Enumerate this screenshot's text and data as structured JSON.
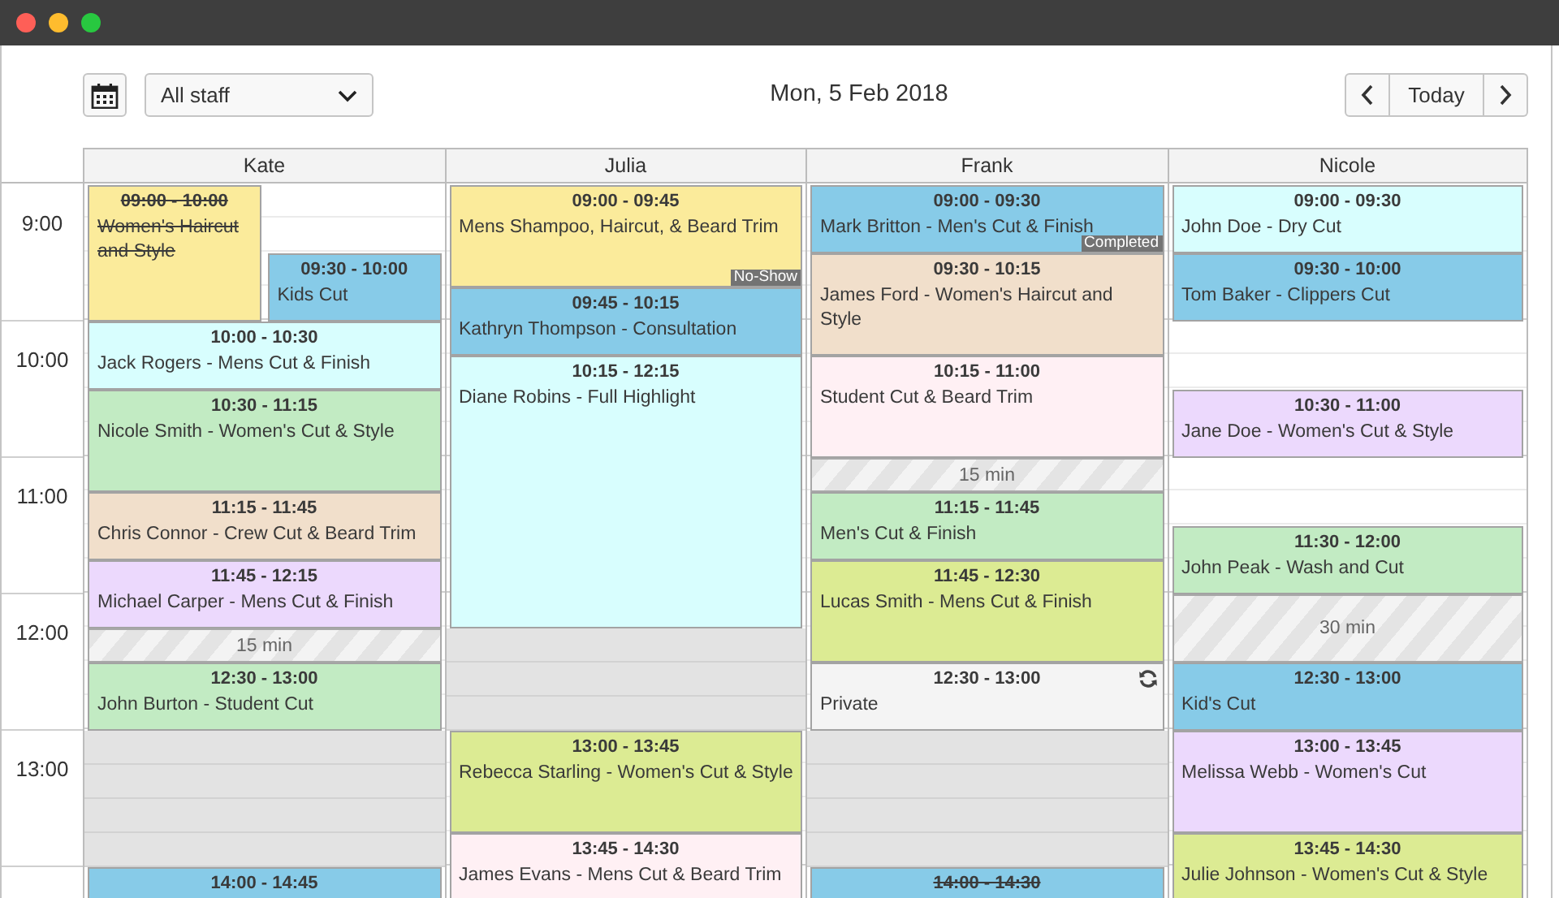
{
  "toolbar": {
    "staff_filter": "All staff",
    "date": "Mon, 5 Feb 2018",
    "today_button": "Today"
  },
  "time_labels": [
    "9:00",
    "10:00",
    "11:00",
    "12:00",
    "13:00"
  ],
  "staff": [
    {
      "name": "Kate",
      "blocks": [
        {
          "kind": "appointment",
          "time": "09:00 - 10:00",
          "title": "Women's Haircut and Style",
          "color": "#fbeb9b",
          "cancelled": true,
          "recurring": false
        },
        {
          "kind": "appointment",
          "time": "09:30 - 10:00",
          "title": "Kids Cut",
          "color": "#87cbe8",
          "cancelled": false,
          "recurring": false
        },
        {
          "kind": "appointment",
          "time": "10:00 - 10:30",
          "title": "Jack Rogers - Mens Cut & Finish",
          "color": "#d8fefe",
          "cancelled": false,
          "recurring": false
        },
        {
          "kind": "appointment",
          "time": "10:30 - 11:15",
          "title": "Nicole Smith - Women's Cut & Style",
          "color": "#c2ebc3",
          "cancelled": false,
          "recurring": false
        },
        {
          "kind": "appointment",
          "time": "11:15 - 11:45",
          "title": "Chris Connor - Crew Cut & Beard Trim",
          "color": "#f1dfcb",
          "cancelled": false,
          "recurring": false
        },
        {
          "kind": "appointment",
          "time": "11:45 - 12:15",
          "title": "Michael Carper - Mens Cut & Finish",
          "color": "#ecd9fd",
          "cancelled": false,
          "recurring": false
        },
        {
          "kind": "break",
          "label": "15 min"
        },
        {
          "kind": "appointment",
          "time": "12:30 - 13:00",
          "title": "John Burton - Student Cut",
          "color": "#c2ebc3",
          "cancelled": false,
          "recurring": false
        },
        {
          "kind": "unavailable"
        },
        {
          "kind": "appointment",
          "time": "14:00 - 14:45",
          "color": "#87cbe8",
          "cancelled": false,
          "recurring": false
        }
      ]
    },
    {
      "name": "Julia",
      "blocks": [
        {
          "kind": "appointment",
          "time": "09:00 - 09:45",
          "title": "Mens Shampoo, Haircut, & Beard Trim",
          "color": "#fbeb9b",
          "cancelled": false,
          "recurring": false,
          "status": "No-Show"
        },
        {
          "kind": "appointment",
          "time": "09:45 - 10:15",
          "title": "Kathryn Thompson - Consultation",
          "color": "#87cbe8",
          "cancelled": false,
          "recurring": false
        },
        {
          "kind": "appointment",
          "time": "10:15 - 12:15",
          "title": "Diane Robins - Full Highlight",
          "color": "#d8fefe",
          "cancelled": false,
          "recurring": false
        },
        {
          "kind": "unavailable"
        },
        {
          "kind": "appointment",
          "time": "13:00 - 13:45",
          "title": "Rebecca Starling - Women's Cut & Style",
          "color": "#dceb93",
          "cancelled": false,
          "recurring": false
        },
        {
          "kind": "appointment",
          "time": "13:45 - 14:30",
          "title": "James Evans - Mens Cut & Beard Trim",
          "color": "#fff0f4",
          "cancelled": false,
          "recurring": false
        }
      ]
    },
    {
      "name": "Frank",
      "blocks": [
        {
          "kind": "appointment",
          "time": "09:00 - 09:30",
          "title": "Mark Britton - Men's Cut & Finish",
          "color": "#87cbe8",
          "cancelled": false,
          "recurring": false,
          "status": "Completed"
        },
        {
          "kind": "appointment",
          "time": "09:30 - 10:15",
          "title": "James Ford - Women's Haircut and Style",
          "color": "#f1dfcb",
          "cancelled": false,
          "recurring": false
        },
        {
          "kind": "appointment",
          "time": "10:15 - 11:00",
          "title": "Student Cut & Beard Trim",
          "color": "#fff0f4",
          "cancelled": false,
          "recurring": false
        },
        {
          "kind": "break",
          "label": "15 min"
        },
        {
          "kind": "appointment",
          "time": "11:15 - 11:45",
          "title": "Men's Cut & Finish",
          "color": "#c2ebc3",
          "cancelled": false,
          "recurring": false
        },
        {
          "kind": "appointment",
          "time": "11:45 - 12:30",
          "title": "Lucas Smith - Mens Cut & Finish",
          "color": "#dceb93",
          "cancelled": false,
          "recurring": false
        },
        {
          "kind": "appointment",
          "time": "12:30 - 13:00",
          "title": "Private",
          "color": "#f4f4f4",
          "cancelled": false,
          "recurring": true
        },
        {
          "kind": "unavailable"
        },
        {
          "kind": "appointment",
          "time": "14:00 - 14:30",
          "color": "#87cbe8",
          "cancelled": true,
          "recurring": false
        }
      ]
    },
    {
      "name": "Nicole",
      "blocks": [
        {
          "kind": "appointment",
          "time": "09:00 - 09:30",
          "title": "John Doe - Dry Cut",
          "color": "#d8fefe",
          "cancelled": false,
          "recurring": false
        },
        {
          "kind": "appointment",
          "time": "09:30 - 10:00",
          "title": "Tom Baker - Clippers Cut",
          "color": "#87cbe8",
          "cancelled": false,
          "recurring": false
        },
        {
          "kind": "appointment",
          "time": "10:30 - 11:00",
          "title": "Jane Doe - Women's Cut & Style",
          "color": "#ecd9fd",
          "cancelled": false,
          "recurring": false
        },
        {
          "kind": "appointment",
          "time": "11:30 - 12:00",
          "title": "John Peak - Wash and Cut",
          "color": "#c2ebc3",
          "cancelled": false,
          "recurring": false
        },
        {
          "kind": "break",
          "label": "30 min"
        },
        {
          "kind": "appointment",
          "time": "12:30 - 13:00",
          "title": "Kid's Cut",
          "color": "#87cbe8",
          "cancelled": false,
          "recurring": false
        },
        {
          "kind": "appointment",
          "time": "13:00 - 13:45",
          "title": "Melissa Webb - Women's Cut",
          "color": "#ecd9fd",
          "cancelled": false,
          "recurring": false
        },
        {
          "kind": "appointment",
          "time": "13:45 - 14:30",
          "title": "Julie Johnson - Women's Cut & Style",
          "color": "#dceb93",
          "cancelled": false,
          "recurring": false
        }
      ]
    }
  ]
}
